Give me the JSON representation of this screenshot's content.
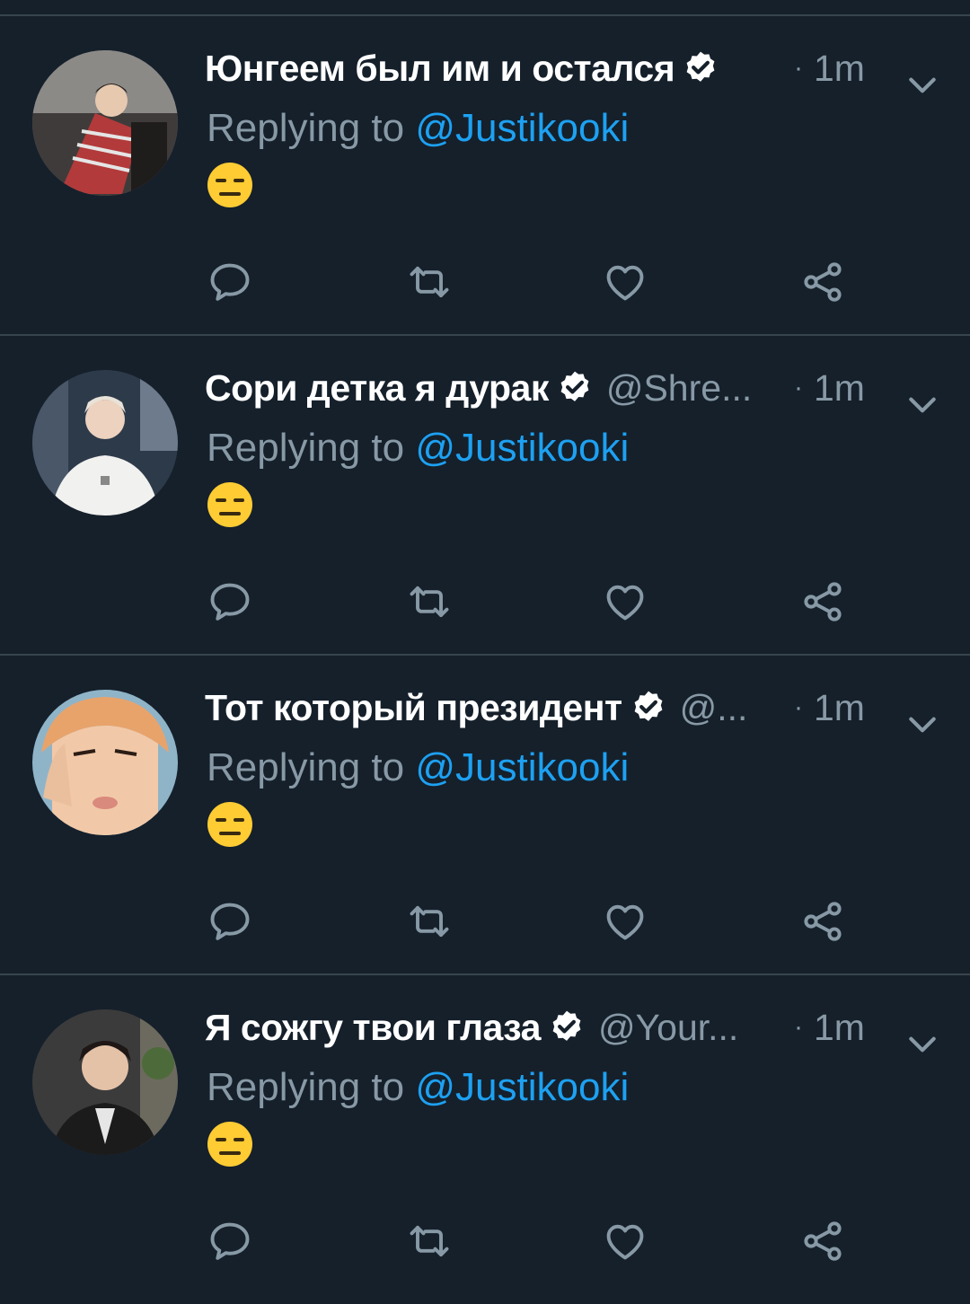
{
  "replying_label": "Replying to",
  "tweets": [
    {
      "name": "Юнгеем был им и остался",
      "handle": "",
      "time": "1m",
      "reply_to": "@Justikooki",
      "emoji": "expressionless-face"
    },
    {
      "name": "Сори детка я дурак",
      "handle": "@Shre...",
      "time": "1m",
      "reply_to": "@Justikooki",
      "emoji": "expressionless-face"
    },
    {
      "name": "Тот который президент",
      "handle": "@...",
      "time": "1m",
      "reply_to": "@Justikooki",
      "emoji": "expressionless-face"
    },
    {
      "name": "Я сожгу твои глаза",
      "handle": "@Your...",
      "time": "1m",
      "reply_to": "@Justikooki",
      "emoji": "expressionless-face"
    }
  ],
  "icons": {
    "verified": "verified-badge-icon",
    "more": "chevron-down-icon",
    "reply": "reply-icon",
    "retweet": "retweet-icon",
    "like": "heart-icon",
    "share": "share-icon"
  },
  "colors": {
    "background": "#15202b",
    "divider": "#38444d",
    "secondary_text": "#8899a6",
    "link": "#1da1f2"
  }
}
